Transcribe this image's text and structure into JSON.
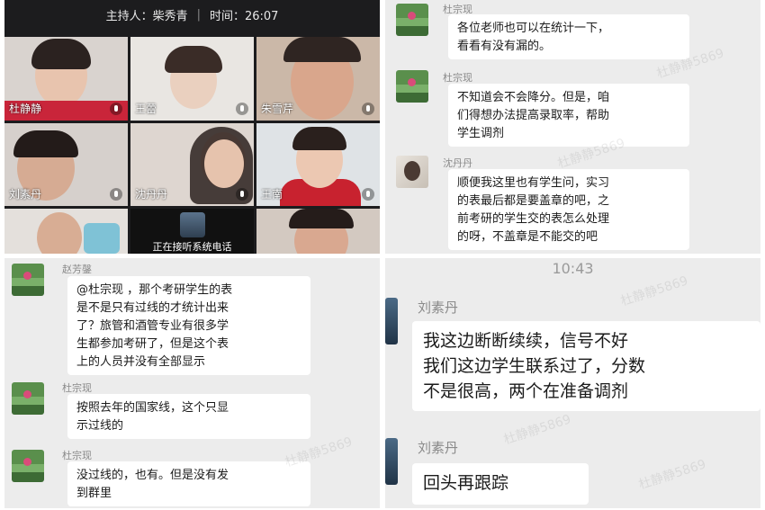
{
  "video": {
    "host_label": "主持人：柴秀青",
    "separator": "|",
    "time_label": "时间：26:07",
    "tiles": [
      {
        "name": "杜静静"
      },
      {
        "name": "王蕾"
      },
      {
        "name": "朱雪芹"
      },
      {
        "name": "刘素丹"
      },
      {
        "name": "沈丹丹"
      },
      {
        "name": "王南"
      },
      {
        "name": ""
      },
      {
        "name": "正在接听系统电话"
      },
      {
        "name": ""
      }
    ]
  },
  "chat_top_right": {
    "messages": [
      {
        "sender": "杜宗现",
        "text": "各位老师也可以在统计一下，\n看看有没有漏的。"
      },
      {
        "sender": "杜宗现",
        "text": "不知道会不会降分。但是，咱\n们得想办法提高录取率，帮助\n学生调剂"
      },
      {
        "sender": "沈丹丹",
        "text": "顺便我这里也有学生问，实习\n的表最后都是要盖章的吧，之\n前考研的学生交的表怎么处理\n的呀，不盖章是不能交的吧"
      }
    ]
  },
  "chat_bottom_left": {
    "messages": [
      {
        "sender": "赵芳鏧",
        "text": "@杜宗现 ，那个考研学生的表\n是不是只有过线的才统计出来\n了？旅管和酒管专业有很多学\n生都参加考研了，但是这个表\n上的人员并没有全部显示"
      },
      {
        "sender": "杜宗现",
        "text": "按照去年的国家线，这个只显\n示过线的"
      },
      {
        "sender": "杜宗现",
        "text": "没过线的，也有。但是没有发\n到群里"
      }
    ]
  },
  "chat_bottom_right": {
    "time": "10:43",
    "messages": [
      {
        "sender": "刘素丹",
        "text": "我这边断断续续，信号不好\n我们这边学生联系过了，分数\n不是很高，两个在准备调剂"
      },
      {
        "sender": "刘素丹",
        "text": "回头再跟踪"
      }
    ],
    "watermark": "杜静静5869"
  }
}
